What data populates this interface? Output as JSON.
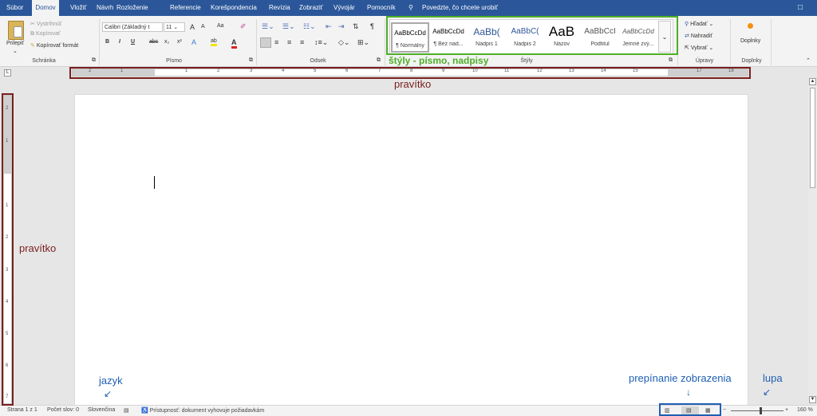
{
  "tabs": [
    "Súbor",
    "Domov",
    "Vložiť",
    "Návrh",
    "Rozloženie",
    "Referencie",
    "Korešpondencia",
    "Revízia",
    "Zobraziť",
    "Vývojár",
    "Pomocník"
  ],
  "tell_me": "Povedzte, čo chcete urobiť",
  "clipboard": {
    "paste": "Prilepiť",
    "cut": "Vystrihnúť",
    "copy": "Kopírovať",
    "format_painter": "Kopírovať formát",
    "label": "Schránka"
  },
  "font": {
    "name": "Calibri (Základný t",
    "size": "11",
    "grow": "A",
    "shrink": "A",
    "case": "Aa",
    "bold": "B",
    "italic": "I",
    "underline": "U",
    "strike": "abc",
    "sub": "x₂",
    "sup": "x²",
    "label": "Písmo"
  },
  "paragraph": {
    "label": "Odsek",
    "pilcrow": "¶"
  },
  "styles": {
    "label": "Štýly",
    "items": [
      {
        "preview": "AaBbCcDd",
        "name": "¶ Normálny"
      },
      {
        "preview": "AaBbCcDd",
        "name": "¶ Bez riad..."
      },
      {
        "preview": "AaBb(",
        "name": "Nadpis 1"
      },
      {
        "preview": "AaBbC(",
        "name": "Nadpis 2"
      },
      {
        "preview": "AaB",
        "name": "Názov"
      },
      {
        "preview": "AaBbCcI",
        "name": "Podtitul"
      },
      {
        "preview": "AaBbCcDd",
        "name": "Jemné zvý..."
      }
    ]
  },
  "editing": {
    "find": "Hľadať",
    "replace": "Nahradiť",
    "select": "Vybrať",
    "label": "Úpravy"
  },
  "addins": {
    "button": "Doplnky",
    "label": "Doplnky"
  },
  "ruler_numbers": [
    "2",
    "1",
    "1",
    "2",
    "3",
    "4",
    "5",
    "6",
    "7",
    "8",
    "9",
    "10",
    "11",
    "12",
    "13",
    "14",
    "15",
    "17",
    "18"
  ],
  "vruler_numbers": [
    "2",
    "1",
    "1",
    "2",
    "3",
    "4",
    "5",
    "6",
    "7"
  ],
  "status": {
    "page": "Strana 1 z 1",
    "words": "Počet slov: 0",
    "language": "Slovenčina",
    "accessibility": "Prístupnosť: dokument vyhovuje požiadavkám",
    "zoom": "160 %"
  },
  "annotations": {
    "ruler_top": "pravítko",
    "ruler_left": "pravítko",
    "styles": "štýly - písmo, nadpisy",
    "language": "jazyk",
    "views": "prepínanie zobrazenia",
    "zoom": "lupa"
  },
  "colors": {
    "ribbon_blue": "#2b579a",
    "ann_red": "#7a1f1f",
    "ann_green": "#4caf26",
    "ann_blue": "#1f5fb4"
  }
}
